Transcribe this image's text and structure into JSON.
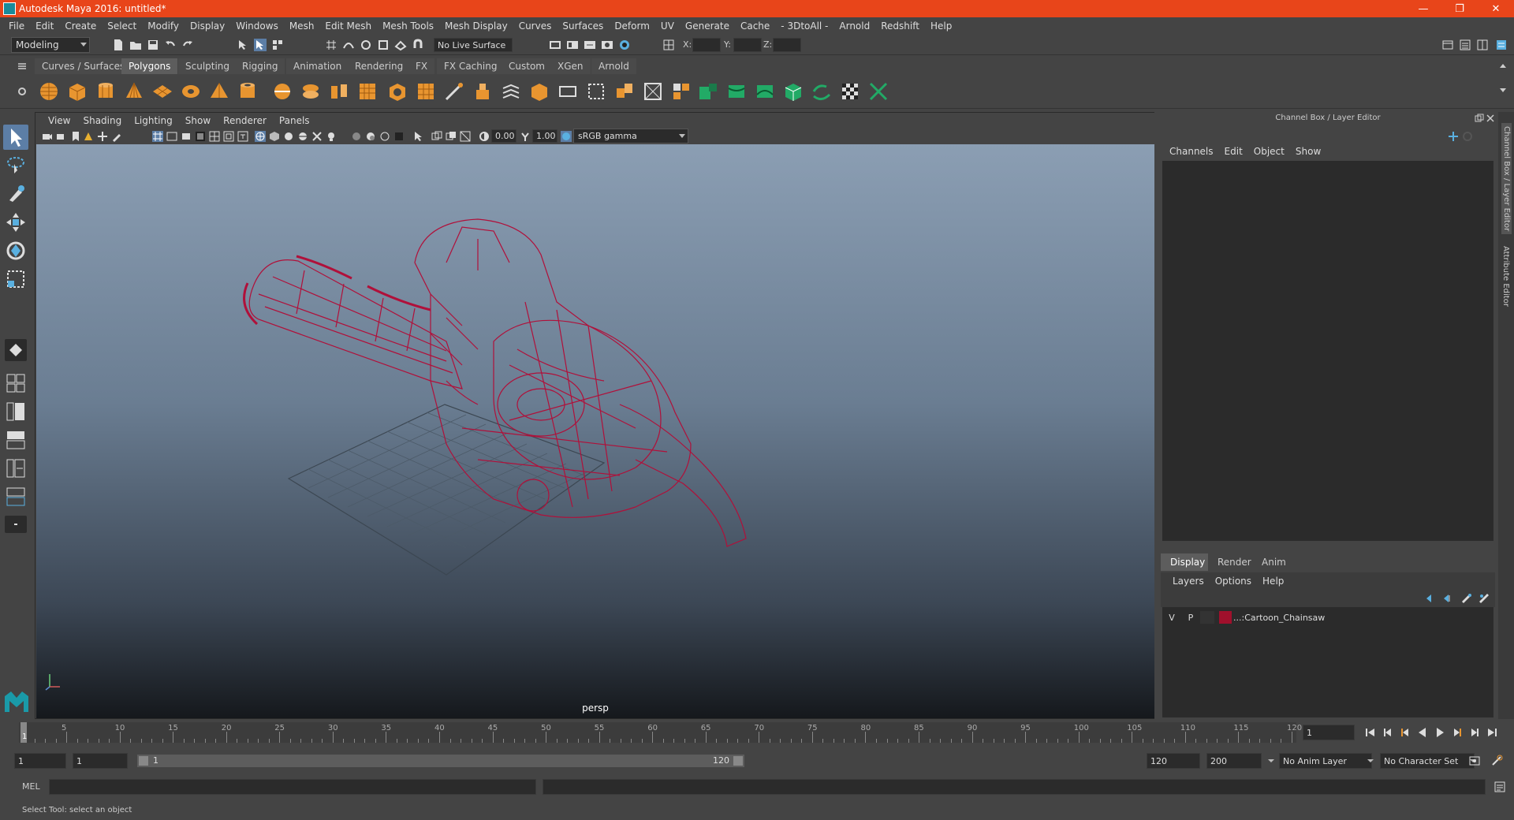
{
  "window": {
    "title": "Autodesk Maya 2016: untitled*",
    "controls": [
      "minimize",
      "restore",
      "close"
    ]
  },
  "menubar": {
    "items": [
      "File",
      "Edit",
      "Create",
      "Select",
      "Modify",
      "Display",
      "Windows",
      "Mesh",
      "Edit Mesh",
      "Mesh Tools",
      "Mesh Display",
      "Curves",
      "Surfaces",
      "Deform",
      "UV",
      "Generate",
      "Cache",
      "- 3DtoAll -",
      "Arnold",
      "Redshift",
      "Help"
    ]
  },
  "statusline": {
    "mode": "Modeling",
    "live_surface": "No Live Surface",
    "x_label": "X:",
    "y_label": "Y:",
    "z_label": "Z:"
  },
  "shelf": {
    "tabs": [
      "Curves / Surfaces",
      "Polygons",
      "Sculpting",
      "Rigging",
      "Animation",
      "Rendering",
      "FX",
      "FX Caching",
      "Custom",
      "XGen",
      "Arnold"
    ],
    "active_tab": "Polygons"
  },
  "viewport": {
    "menu": [
      "View",
      "Shading",
      "Lighting",
      "Show",
      "Renderer",
      "Panels"
    ],
    "exposure": "0.00",
    "gamma": "1.00",
    "color_space": "sRGB gamma",
    "camera_label": "persp",
    "wire_color": "#b0103a"
  },
  "right_panel": {
    "title": "Channel Box / Layer Editor",
    "menu": [
      "Channels",
      "Edit",
      "Object",
      "Show"
    ],
    "layer_tabs": [
      "Display",
      "Render",
      "Anim"
    ],
    "active_layer_tab": "Display",
    "layer_menu": [
      "Layers",
      "Options",
      "Help"
    ],
    "layers": [
      {
        "visible": "V",
        "playback": "P",
        "color": "#a0102c",
        "name": "...:Cartoon_Chainsaw"
      }
    ],
    "side_tabs": [
      "Channel Box / Layer Editor",
      "Attribute Editor"
    ]
  },
  "timeline": {
    "ticks": [
      "1",
      "5",
      "10",
      "15",
      "20",
      "25",
      "30",
      "35",
      "40",
      "45",
      "50",
      "55",
      "60",
      "65",
      "70",
      "75",
      "80",
      "85",
      "90",
      "95",
      "100",
      "105",
      "110",
      "115",
      "120"
    ],
    "current_frame": "1"
  },
  "range": {
    "start": "1",
    "playback_start": "1",
    "slider_start": "1",
    "slider_end": "120",
    "playback_end": "120",
    "end": "200",
    "anim_layer": "No Anim Layer",
    "character_set": "No Character Set"
  },
  "command": {
    "language": "MEL"
  },
  "help": {
    "text": "Select Tool: select an object"
  }
}
